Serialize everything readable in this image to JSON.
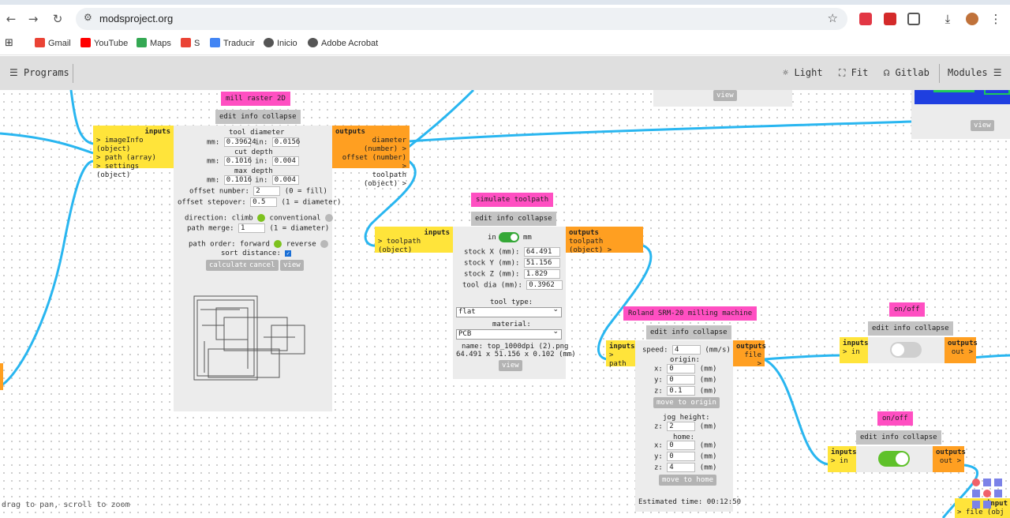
{
  "browser": {
    "url": "modsproject.org",
    "bookmarks": [
      "Gmail",
      "YouTube",
      "Maps",
      "S",
      "Traducir",
      "Inicio",
      "Adobe Acrobat"
    ]
  },
  "toolbar": {
    "programs": "Programs",
    "light": "Light",
    "fit": "Fit",
    "gitlab": "Gitlab",
    "modules": "Modules"
  },
  "common": {
    "edit_info_collapse": "edit info collapse",
    "inputs": "inputs",
    "outputs": "outputs",
    "view": "view"
  },
  "mill": {
    "title": "mill raster 2D",
    "inputs": [
      "> imageInfo (object)",
      "> path (array)",
      "> settings (object)"
    ],
    "outputs": [
      "diameter (number) >",
      "offset (number) >",
      "toolpath (object) >"
    ],
    "tool_diameter": "tool diameter",
    "mm_label": "mm:",
    "in_label": "in:",
    "tool_diameter_mm": "0.39624",
    "tool_diameter_in": "0.0156",
    "cut_depth": "cut depth",
    "cut_depth_mm": "0.1016",
    "cut_depth_in": "0.004",
    "max_depth": "max depth",
    "max_depth_mm": "0.1016",
    "max_depth_in": "0.004",
    "offset_number_label": "offset number:",
    "offset_number": "2",
    "offset_number_hint": "(0 = fill)",
    "offset_stepover_label": "offset stepover:",
    "offset_stepover": "0.5",
    "offset_stepover_hint": "(1 = diameter)",
    "direction_label": "direction: climb",
    "conventional": "conventional",
    "path_merge_label": "path merge:",
    "path_merge": "1",
    "path_merge_hint": "(1 = diameter)",
    "path_order_label": "path order: forward",
    "reverse": "reverse",
    "sort_distance": "sort distance:",
    "calculate": "calculate",
    "cancel": "cancel",
    "view": "view"
  },
  "simulate": {
    "title": "simulate toolpath",
    "input": "> toolpath (object)",
    "output": "toolpath (object) >",
    "in": "in",
    "mm": "mm",
    "stock_x_label": "stock X (mm):",
    "stock_x": "64.491",
    "stock_y_label": "stock Y (mm):",
    "stock_y": "51.156",
    "stock_z_label": "stock Z (mm):",
    "stock_z": "1.829",
    "tool_dia_label": "tool dia (mm):",
    "tool_dia": "0.3962",
    "tool_type_label": "tool type:",
    "tool_type": "flat",
    "material_label": "material:",
    "material": "PCB",
    "name": "name: top_1000dpi (2).png",
    "dims": "64.491 x 51.156 x 0.102 (mm)",
    "view": "view"
  },
  "roland": {
    "title": "Roland SRM-20 milling machine",
    "input": "> path",
    "output": "file >",
    "speed_label": "speed:",
    "speed": "4",
    "speed_unit": "(mm/s)",
    "origin_label": "origin:",
    "x_label": "x:",
    "y_label": "y:",
    "z_label": "z:",
    "mm_unit": "(mm)",
    "origin_x": "0",
    "origin_y": "0",
    "origin_z": "0.1",
    "move_to_origin": "move to origin",
    "jog_height_label": "jog height:",
    "jog_z": "2",
    "home_label": "home:",
    "home_x": "0",
    "home_y": "0",
    "home_z": "4",
    "move_to_home": "move to home",
    "estimated_time": "Estimated time: 00:12:50"
  },
  "onoff1": {
    "title": "on/off",
    "input": "> in",
    "output": "out >",
    "state": false
  },
  "onoff2": {
    "title": "on/off",
    "input": "> in",
    "output": "out >",
    "state": true
  },
  "partial": {
    "inputs": "input",
    "file": "> file (obj"
  },
  "hint": "drag to pan, scroll to zoom",
  "colors": {
    "wire": "#29b6f0",
    "title": "#ff4fc2",
    "inputs": "#ffe43a",
    "outputs": "#ff9f21",
    "toggle_on": "#5fc12a",
    "indicator": "#7dc21e"
  }
}
